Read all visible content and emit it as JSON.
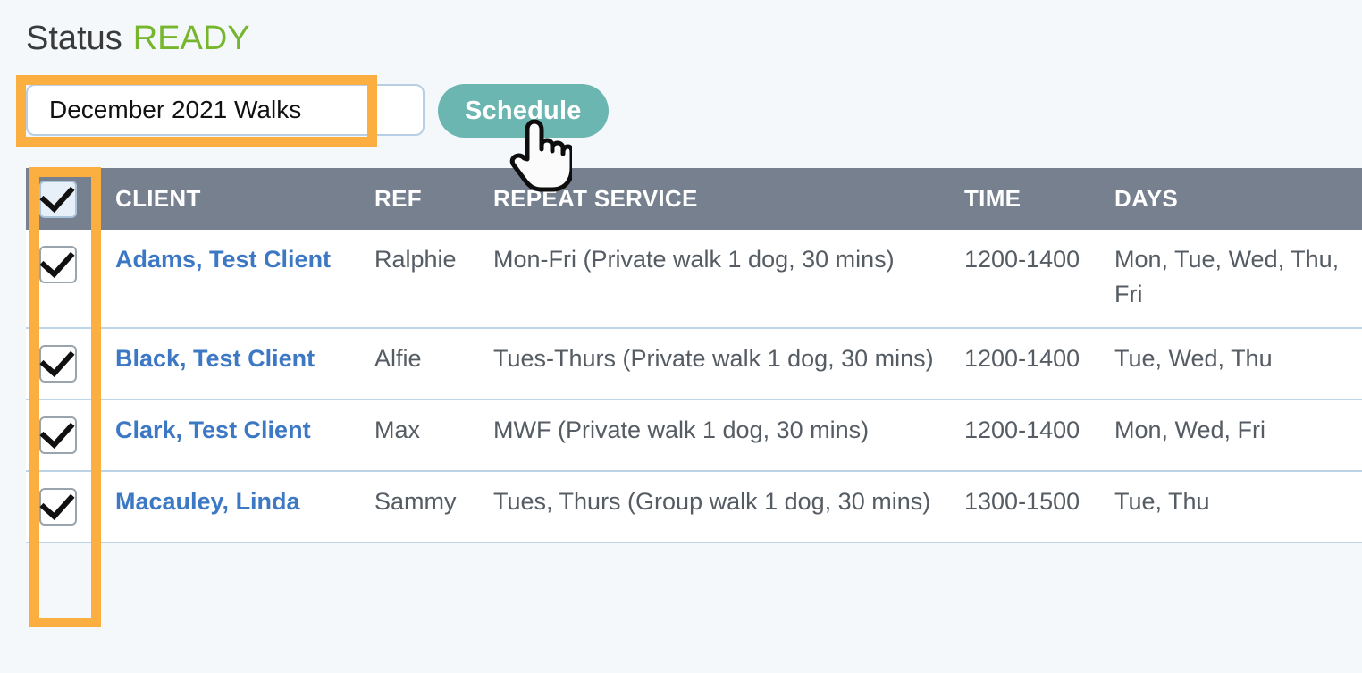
{
  "status": {
    "label": "Status",
    "value": "READY"
  },
  "controls": {
    "schedule_name_value": "December 2021 Walks",
    "schedule_name_placeholder": "",
    "schedule_button_label": "Schedule"
  },
  "colors": {
    "page_background": "#f4f8fb",
    "status_ready": "#76b62c",
    "highlight_orange": "#fbaf40",
    "table_header_bg": "#76808f",
    "schedule_button_bg": "#6cb6b1",
    "client_link": "#3c78c4",
    "row_border": "#bcd4e6"
  },
  "table": {
    "columns": [
      "",
      "CLIENT",
      "REF",
      "REPEAT SERVICE",
      "TIME",
      "DAYS"
    ],
    "select_all_checked": true,
    "rows": [
      {
        "checked": true,
        "client": "Adams, Test Client",
        "ref": "Ralphie",
        "service": "Mon-Fri (Private walk 1 dog, 30 mins)",
        "time": "1200-1400",
        "days": "Mon, Tue, Wed, Thu, Fri"
      },
      {
        "checked": true,
        "client": "Black, Test Client",
        "ref": "Alfie",
        "service": "Tues-Thurs (Private walk 1 dog, 30 mins)",
        "time": "1200-1400",
        "days": "Tue, Wed, Thu"
      },
      {
        "checked": true,
        "client": "Clark, Test Client",
        "ref": "Max",
        "service": "MWF (Private walk 1 dog, 30 mins)",
        "time": "1200-1400",
        "days": "Mon, Wed, Fri"
      },
      {
        "checked": true,
        "client": "Macauley, Linda",
        "ref": "Sammy",
        "service": "Tues, Thurs (Group walk 1 dog, 30 mins)",
        "time": "1300-1500",
        "days": "Tue, Thu"
      }
    ]
  },
  "annotations": {
    "name_field_highlight": "schedule-name-field-highlight",
    "select_column_highlight": "select-all-column-highlight"
  },
  "cursor": {
    "icon": "pointing-hand-cursor"
  }
}
